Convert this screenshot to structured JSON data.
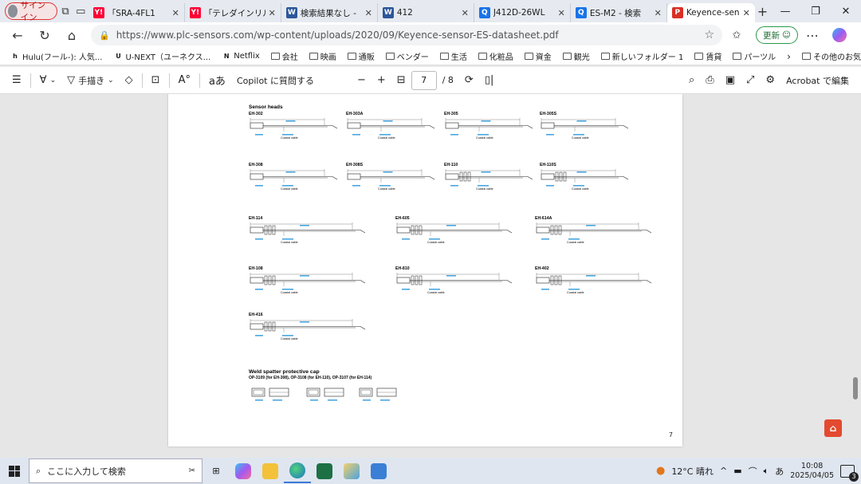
{
  "browser": {
    "profile_label": "サインイン",
    "tabs": [
      {
        "label": "「SRA-4FL1",
        "favicon": "Y!",
        "fav_color": "#ff0033"
      },
      {
        "label": "「テレダインリル",
        "favicon": "Y!",
        "fav_color": "#ff0033"
      },
      {
        "label": "検索結果なし -",
        "favicon": "W",
        "fav_color": "#2b579a"
      },
      {
        "label": "412",
        "favicon": "W",
        "fav_color": "#2b579a"
      },
      {
        "label": "J412D-26WL",
        "favicon": "Q",
        "fav_color": "#1a73e8"
      },
      {
        "label": "ES-M2 - 検索",
        "favicon": "Q",
        "fav_color": "#1a73e8"
      },
      {
        "label": "Keyence-sens",
        "favicon": "P",
        "fav_color": "#d93025",
        "active": true
      }
    ],
    "url": "https://www.plc-sensors.com/wp-content/uploads/2020/09/Keyence-sensor-ES-datasheet.pdf",
    "update_label": "更新",
    "bookmarks": [
      {
        "label": "Hulu(フール-): 人気...",
        "type": "site",
        "badge": "h"
      },
      {
        "label": "U-NEXT（ユーネクス...",
        "type": "site",
        "badge": "U"
      },
      {
        "label": "Netflix",
        "type": "site",
        "badge": "N"
      },
      {
        "label": "会社",
        "type": "folder"
      },
      {
        "label": "映画",
        "type": "folder"
      },
      {
        "label": "通販",
        "type": "folder"
      },
      {
        "label": "ベンダー",
        "type": "folder"
      },
      {
        "label": "生活",
        "type": "folder"
      },
      {
        "label": "化粧品",
        "type": "folder"
      },
      {
        "label": "資金",
        "type": "folder"
      },
      {
        "label": "観光",
        "type": "folder"
      },
      {
        "label": "新しいフォルダー 1",
        "type": "folder"
      },
      {
        "label": "賃貸",
        "type": "folder"
      },
      {
        "label": "パーツル",
        "type": "folder"
      }
    ],
    "other_favorites": "その他のお気に入り"
  },
  "pdf_toolbar": {
    "draw_label": "手描き",
    "copilot_label": "Copilot に質問する",
    "current_page": "7",
    "total_pages": "/ 8",
    "acrobat_label": "Acrobat で編集"
  },
  "pdf_page": {
    "section_heads": "Sensor heads",
    "models": [
      "EH-302",
      "EH-303A",
      "EH-305",
      "EH-305S",
      "EH-308",
      "EH-308S",
      "EH-110",
      "EH-110S",
      "EH-114",
      "EH-605",
      "EH-614A",
      "EH-108",
      "EH-810",
      "EH-402",
      "EH-416"
    ],
    "cable_note": "Coaxial cable",
    "weld_title": "Weld spatter protective cap",
    "weld_sub": "OP-3109 (for EH-308), OP-3108 (for EH-110), OP-3107 (for EH-114)",
    "page_number": "7"
  },
  "taskbar": {
    "search_placeholder": "ここに入力して検索",
    "weather": "12°C 晴れ",
    "ime": "あ",
    "time": "10:08",
    "date": "2025/04/05",
    "notification_count": "3"
  }
}
